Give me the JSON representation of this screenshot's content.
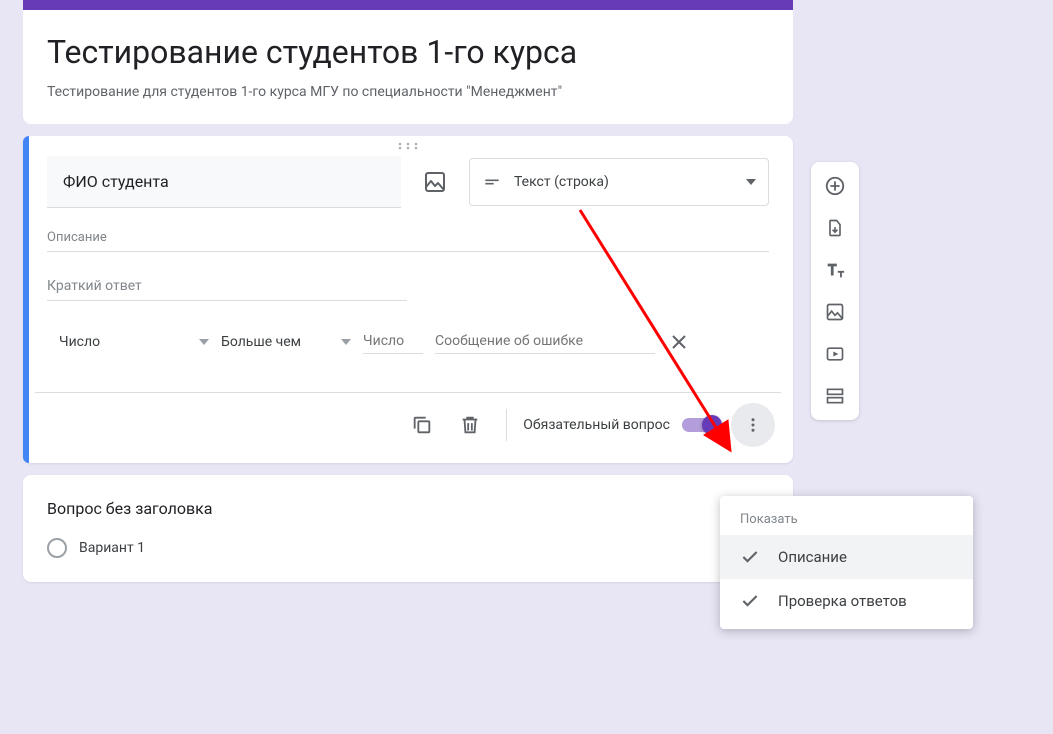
{
  "header": {
    "title": "Тестирование студентов 1-го курса",
    "description": "Тестирование для студентов 1-го курса МГУ по специальности \"Менеджмент\""
  },
  "question": {
    "title_value": "ФИО студента",
    "type_label": "Текст (строка)",
    "description_placeholder": "Описание",
    "short_answer_placeholder": "Краткий ответ",
    "validation": {
      "type": "Число",
      "condition": "Больше чем",
      "number_placeholder": "Число",
      "error_placeholder": "Сообщение об ошибке"
    },
    "required_label": "Обязательный вопрос",
    "required_on": true
  },
  "second_question": {
    "title": "Вопрос без заголовка",
    "option1": "Вариант 1"
  },
  "popup": {
    "header": "Показать",
    "item_description": "Описание",
    "item_validation": "Проверка ответов"
  }
}
